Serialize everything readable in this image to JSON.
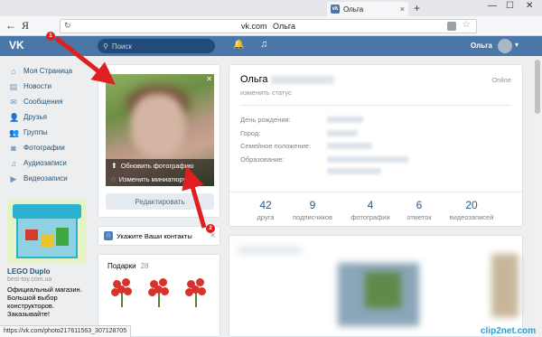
{
  "browser": {
    "tab_title": "Ольга",
    "tab_close": "×",
    "new_tab": "+",
    "url_domain": "vk.com",
    "url_title": "Ольга",
    "yandex_logo": "Я",
    "win_min": "—",
    "win_max": "☐",
    "win_close": "✕"
  },
  "header": {
    "logo": "VK",
    "search_placeholder": "Поиск",
    "user_name": "Ольга"
  },
  "sidebar": {
    "items": [
      {
        "label": "Моя Страница",
        "icon": "home-icon",
        "glyph": "⌂"
      },
      {
        "label": "Новости",
        "icon": "news-icon",
        "glyph": "▤"
      },
      {
        "label": "Сообщения",
        "icon": "messages-icon",
        "glyph": "✉"
      },
      {
        "label": "Друзья",
        "icon": "friends-icon",
        "glyph": "👤"
      },
      {
        "label": "Группы",
        "icon": "groups-icon",
        "glyph": "👥"
      },
      {
        "label": "Фотографии",
        "icon": "photos-icon",
        "glyph": "◙"
      },
      {
        "label": "Аудиозаписи",
        "icon": "audio-icon",
        "glyph": "♫"
      },
      {
        "label": "Видеозаписи",
        "icon": "video-icon",
        "glyph": "▶"
      }
    ]
  },
  "ad": {
    "title": "LEGO Duplo",
    "domain": "best-toy.com.ua",
    "text": "Официальный магазин. Большой выбор конструкторов. Заказывайте!"
  },
  "photo": {
    "update_label": "Обновить фотографию",
    "thumbnail_label": "Изменить миниатюру",
    "edit_button": "Редактировать"
  },
  "notification": {
    "text": "Укажите Ваши контакты"
  },
  "gifts": {
    "title": "Подарки",
    "count": "28"
  },
  "profile": {
    "name": "Ольга",
    "status_link": "изменить статус",
    "online": "Online",
    "info_labels": [
      "День рождения:",
      "Город:",
      "Семейное положение:",
      "Образование:"
    ],
    "stats": [
      {
        "value": "42",
        "label": "друга"
      },
      {
        "value": "9",
        "label": "подписчиков"
      },
      {
        "value": "4",
        "label": "фотографии"
      },
      {
        "value": "6",
        "label": "отметок"
      },
      {
        "value": "20",
        "label": "видеозаписей"
      }
    ]
  },
  "statusbar": {
    "url": "https://vk.com/photo217611563_307128705"
  },
  "watermark": "clip2net.com",
  "annotations": {
    "badge1": "1",
    "badge2": "2"
  },
  "colors": {
    "vk_blue": "#4a76a8",
    "link": "#2a5885",
    "arrow": "#e02020"
  }
}
